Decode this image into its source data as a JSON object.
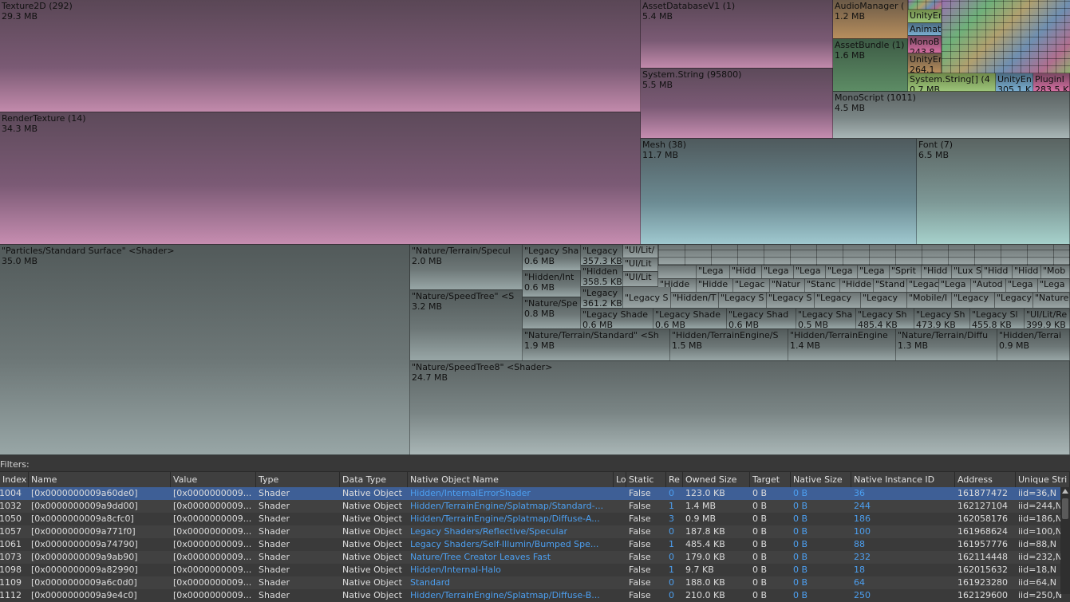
{
  "treemap": {
    "top": [
      {
        "name": "Texture2D (292)",
        "size": "29.3 MB"
      },
      {
        "name": "RenderTexture (14)",
        "size": "34.3 MB"
      },
      {
        "name": "AssetDatabaseV1 (1)",
        "size": "5.4 MB"
      },
      {
        "name": "System.String (95800)",
        "size": "5.5 MB"
      },
      {
        "name": "AudioManager (",
        "size": "1.2 MB"
      },
      {
        "name": "AssetBundle (1)",
        "size": "1.6 MB"
      },
      {
        "name": "UnityEr",
        "size": ""
      },
      {
        "name": "Animat",
        "size": ""
      },
      {
        "name": "MonoB",
        "size": "243.8"
      },
      {
        "name": "UnityEr",
        "size": "264.1"
      },
      {
        "name": "System.String[] (4",
        "size": "0.7 MB"
      },
      {
        "name": "UnityEn",
        "size": "305.1 K"
      },
      {
        "name": "PluginI",
        "size": "283.5 K"
      },
      {
        "name": "MonoScript (1011)",
        "size": "4.5 MB"
      },
      {
        "name": "Mesh (38)",
        "size": "11.7 MB"
      },
      {
        "name": "Font (7)",
        "size": "6.5 MB"
      }
    ],
    "shaders": [
      {
        "name": "\"Particles/Standard Surface\" <Shader>",
        "size": "35.0 MB"
      },
      {
        "name": "\"Nature/Terrain/Specul",
        "size": "2.0 MB"
      },
      {
        "name": "\"Nature/SpeedTree\" <S",
        "size": "3.2 MB"
      },
      {
        "name": "\"Legacy Sha",
        "size": "0.6 MB"
      },
      {
        "name": "\"Legacy",
        "size": "357.3 KB"
      },
      {
        "name": "\"Hidden/Int",
        "size": "0.6 MB"
      },
      {
        "name": "\"Hidden",
        "size": "358.5 KB"
      },
      {
        "name": "\"Legacy",
        "size": "361.2 KB"
      },
      {
        "name": "\"Nature/Spe",
        "size": "0.8 MB"
      },
      {
        "name": "\"Legacy Shade",
        "size": "0.6 MB"
      },
      {
        "name": "\"Legacy Shade",
        "size": "0.6 MB"
      },
      {
        "name": "\"Legacy Shad",
        "size": "0.6 MB"
      },
      {
        "name": "\"Legacy Sha",
        "size": "0.5 MB"
      },
      {
        "name": "\"Legacy Sh",
        "size": "485.4 KB"
      },
      {
        "name": "\"Legacy Sh",
        "size": "473.9 KB"
      },
      {
        "name": "\"Legacy Sl",
        "size": "455.8 KB"
      },
      {
        "name": "\"UI/Lit/Re",
        "size": "399.9 KB"
      },
      {
        "name": "\"Nature/Terrain/Standard\" <Sh",
        "size": "1.9 MB"
      },
      {
        "name": "\"Hidden/TerrainEngine/S",
        "size": "1.5 MB"
      },
      {
        "name": "\"Hidden/TerrainEngine",
        "size": "1.4 MB"
      },
      {
        "name": "\"Nature/Terrain/Diffu",
        "size": "1.3 MB"
      },
      {
        "name": "\"Hidden/Terrai",
        "size": "0.9 MB"
      },
      {
        "name": "\"Nature/SpeedTree8\" <Shader>",
        "size": "24.7 MB"
      }
    ],
    "small_labels": [
      "\"UI/Lit/",
      "\"UI/Lit",
      "\"UI/Lit",
      "\"Lega",
      "\"Hidd",
      "\"Lega",
      "\"Lega",
      "\"Lega",
      "\"Lega",
      "\"Sprit",
      "\"Hidd",
      "\"Lux S",
      "\"Hidd",
      "\"Hidd",
      "\"Mob",
      "\"Hidde",
      "\"Hidde",
      "\"Legac",
      "\"Natur",
      "\"Stanc",
      "\"Hidde",
      "\"Stand",
      "\"Legac",
      "\"Lega",
      "\"Autod",
      "\"Lega",
      "\"Lega",
      "\"Legacy S",
      "\"Hidden/T",
      "\"Legacy S",
      "\"Legacy S",
      "\"Legacy",
      "\"Legacy",
      "\"Mobile/I",
      "\"Legacy",
      "\"Legacy",
      "\"Nature"
    ]
  },
  "filters_label": "Filters:",
  "columns": [
    "Index",
    "Name",
    "Value",
    "Type",
    "Data Type",
    "Native Object Name",
    "Lo",
    "Static",
    "Re",
    "Owned Size",
    "Target",
    "Native Size",
    "Native Instance ID",
    "Address",
    "Unique Stri"
  ],
  "rows": [
    {
      "index": "1004",
      "name": "[0x0000000009a60de0]",
      "value": "[0x0000000009...",
      "type": "Shader",
      "datatype": "Native Object",
      "nativename": "Hidden/InternalErrorShader",
      "static": "False",
      "re": "0",
      "owned": "123.0 KB",
      "target": "0 B",
      "nsize": "0 B",
      "niid": "36",
      "address": "161877472",
      "unique": "iid=36,N",
      "selected": true
    },
    {
      "index": "1032",
      "name": "[0x0000000009a9dd00]",
      "value": "[0x0000000009...",
      "type": "Shader",
      "datatype": "Native Object",
      "nativename": "Hidden/TerrainEngine/Splatmap/Standard-...",
      "static": "False",
      "re": "1",
      "owned": "1.4 MB",
      "target": "0 B",
      "nsize": "0 B",
      "niid": "244",
      "address": "162127104",
      "unique": "iid=244,N"
    },
    {
      "index": "1050",
      "name": "[0x0000000009a8cfc0]",
      "value": "[0x0000000009...",
      "type": "Shader",
      "datatype": "Native Object",
      "nativename": "Hidden/TerrainEngine/Splatmap/Diffuse-A...",
      "static": "False",
      "re": "3",
      "owned": "0.9 MB",
      "target": "0 B",
      "nsize": "0 B",
      "niid": "186",
      "address": "162058176",
      "unique": "iid=186,N"
    },
    {
      "index": "1057",
      "name": "[0x0000000009a771f0]",
      "value": "[0x0000000009...",
      "type": "Shader",
      "datatype": "Native Object",
      "nativename": "Legacy Shaders/Reflective/Specular",
      "static": "False",
      "re": "0",
      "owned": "187.8 KB",
      "target": "0 B",
      "nsize": "0 B",
      "niid": "100",
      "address": "161968624",
      "unique": "iid=100,N"
    },
    {
      "index": "1061",
      "name": "[0x0000000009a74790]",
      "value": "[0x0000000009...",
      "type": "Shader",
      "datatype": "Native Object",
      "nativename": "Legacy Shaders/Self-Illumin/Bumped Spe...",
      "static": "False",
      "re": "1",
      "owned": "485.4 KB",
      "target": "0 B",
      "nsize": "0 B",
      "niid": "88",
      "address": "161957776",
      "unique": "iid=88,N"
    },
    {
      "index": "1073",
      "name": "[0x0000000009a9ab90]",
      "value": "[0x0000000009...",
      "type": "Shader",
      "datatype": "Native Object",
      "nativename": "Nature/Tree Creator Leaves Fast",
      "static": "False",
      "re": "0",
      "owned": "179.0 KB",
      "target": "0 B",
      "nsize": "0 B",
      "niid": "232",
      "address": "162114448",
      "unique": "iid=232,N"
    },
    {
      "index": "1098",
      "name": "[0x0000000009a82990]",
      "value": "[0x0000000009...",
      "type": "Shader",
      "datatype": "Native Object",
      "nativename": "Hidden/Internal-Halo",
      "static": "False",
      "re": "1",
      "owned": "9.7 KB",
      "target": "0 B",
      "nsize": "0 B",
      "niid": "18",
      "address": "162015632",
      "unique": "iid=18,N"
    },
    {
      "index": "1109",
      "name": "[0x0000000009a6c0d0]",
      "value": "[0x0000000009...",
      "type": "Shader",
      "datatype": "Native Object",
      "nativename": "Standard",
      "static": "False",
      "re": "0",
      "owned": "188.0 KB",
      "target": "0 B",
      "nsize": "0 B",
      "niid": "64",
      "address": "161923280",
      "unique": "iid=64,N"
    },
    {
      "index": "1112",
      "name": "[0x0000000009a9e4c0]",
      "value": "[0x0000000009...",
      "type": "Shader",
      "datatype": "Native Object",
      "nativename": "Hidden/TerrainEngine/Splatmap/Diffuse-B...",
      "static": "False",
      "re": "0",
      "owned": "210.0 KB",
      "target": "0 B",
      "nsize": "0 B",
      "niid": "250",
      "address": "162129600",
      "unique": "iid=250,N"
    }
  ]
}
